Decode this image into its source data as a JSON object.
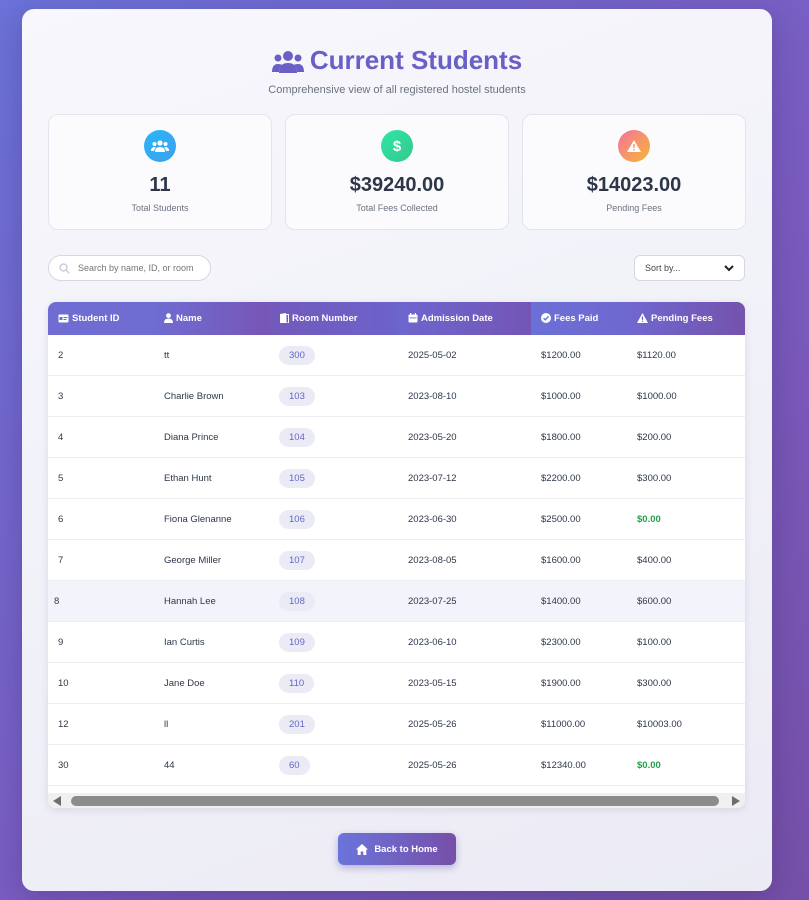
{
  "header": {
    "title": "Current Students",
    "subtitle": "Comprehensive view of all registered hostel students"
  },
  "stats": [
    {
      "value": "11",
      "label": "Total Students",
      "icon": "users-icon",
      "color": "#29b6f6"
    },
    {
      "value": "$39240.00",
      "label": "Total Fees Collected",
      "icon": "dollar-icon",
      "color": "#34d399"
    },
    {
      "value": "$14023.00",
      "label": "Pending Fees",
      "icon": "warning-icon",
      "color": "#f5a623"
    }
  ],
  "search": {
    "placeholder": "Search by name, ID, or room"
  },
  "sort": {
    "label": "Sort by..."
  },
  "table": {
    "headers": [
      "Student ID",
      "Name",
      "Room Number",
      "Admission Date",
      "Fees Paid",
      "Pending Fees"
    ],
    "rows": [
      {
        "id": "2",
        "name": "tt",
        "room": "300",
        "date": "2025-05-02",
        "paid": "$1200.00",
        "pending": "$1120.00"
      },
      {
        "id": "3",
        "name": "Charlie Brown",
        "room": "103",
        "date": "2023-08-10",
        "paid": "$1000.00",
        "pending": "$1000.00"
      },
      {
        "id": "4",
        "name": "Diana Prince",
        "room": "104",
        "date": "2023-05-20",
        "paid": "$1800.00",
        "pending": "$200.00"
      },
      {
        "id": "5",
        "name": "Ethan Hunt",
        "room": "105",
        "date": "2023-07-12",
        "paid": "$2200.00",
        "pending": "$300.00"
      },
      {
        "id": "6",
        "name": "Fiona Glenanne",
        "room": "106",
        "date": "2023-06-30",
        "paid": "$2500.00",
        "pending": "$0.00"
      },
      {
        "id": "7",
        "name": "George Miller",
        "room": "107",
        "date": "2023-08-05",
        "paid": "$1600.00",
        "pending": "$400.00"
      },
      {
        "id": "8",
        "name": "Hannah Lee",
        "room": "108",
        "date": "2023-07-25",
        "paid": "$1400.00",
        "pending": "$600.00"
      },
      {
        "id": "9",
        "name": "Ian Curtis",
        "room": "109",
        "date": "2023-06-10",
        "paid": "$2300.00",
        "pending": "$100.00"
      },
      {
        "id": "10",
        "name": "Jane Doe",
        "room": "110",
        "date": "2023-05-15",
        "paid": "$1900.00",
        "pending": "$300.00"
      },
      {
        "id": "12",
        "name": "ll",
        "room": "201",
        "date": "2025-05-26",
        "paid": "$11000.00",
        "pending": "$10003.00"
      },
      {
        "id": "30",
        "name": "44",
        "room": "60",
        "date": "2025-05-26",
        "paid": "$12340.00",
        "pending": "$0.00"
      }
    ]
  },
  "back_button": {
    "label": "Back to Home"
  }
}
